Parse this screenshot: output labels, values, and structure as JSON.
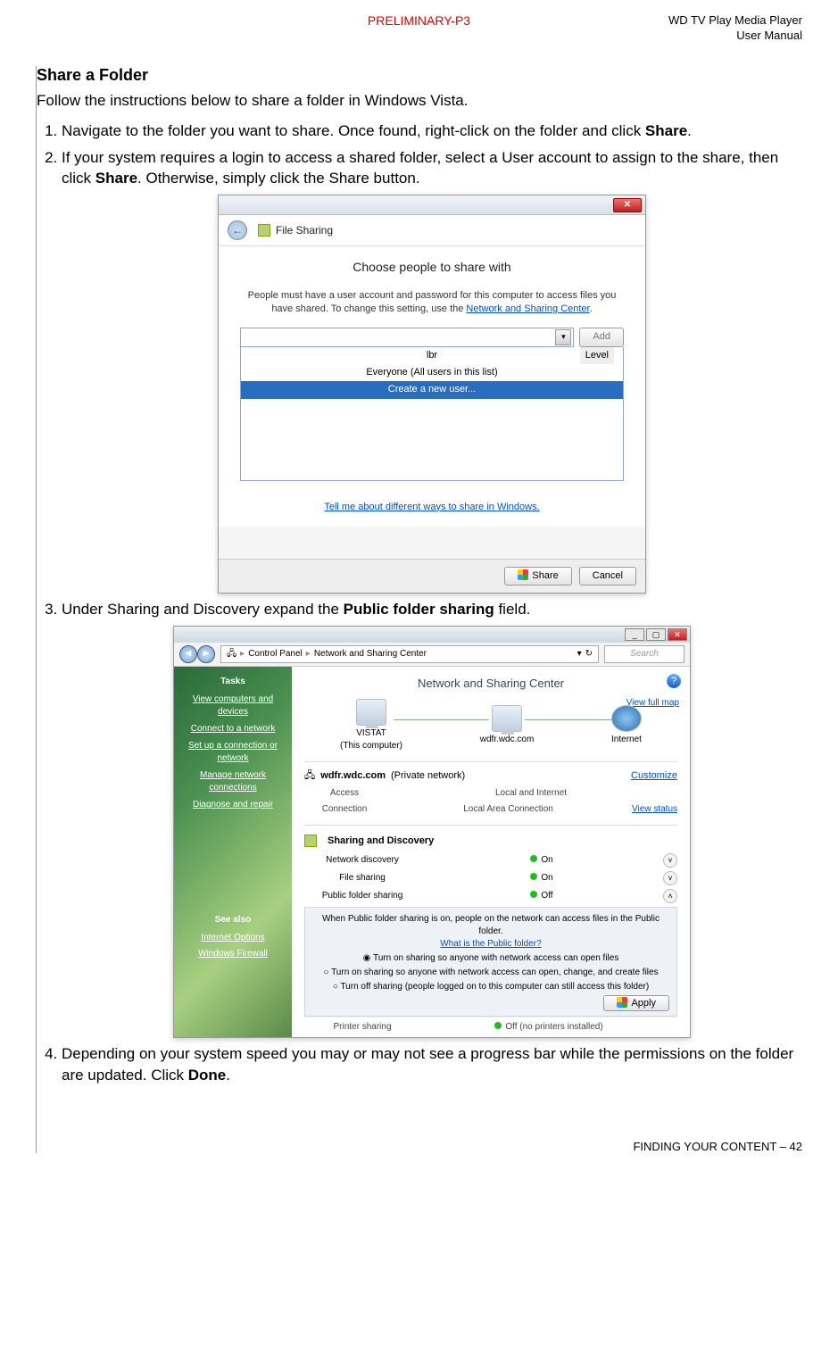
{
  "header": {
    "preliminary": "PRELIMINARY-P3",
    "product": "WD TV Play Media Player",
    "manual": "User Manual"
  },
  "section_title": "Share a Folder",
  "intro": "Follow the instructions below to share a folder in Windows Vista.",
  "steps": {
    "s1_a": "Navigate to the folder you want to share. Once found, right-click on the folder and click ",
    "s1_b": "Share",
    "s1_c": ".",
    "s2_a": "If your system requires a login to access a shared folder, select a User account to assign to the share, then click ",
    "s2_b": "Share",
    "s2_c": ". Otherwise, simply click the Share button.",
    "s3_a": "Under Sharing and Discovery expand the ",
    "s3_b": "Public folder sharing",
    "s3_c": " field.",
    "s4_a": "Depending on your system speed you may or may not see a progress bar while the permissions on the folder are updated. Click ",
    "s4_b": "Done",
    "s4_c": "."
  },
  "shot1": {
    "toolbar_title": "File Sharing",
    "heading": "Choose people to share with",
    "desc_a": "People must have a user account and password for this computer to access files you have shared.  To change this setting, use the ",
    "desc_link": "Network and Sharing Center",
    "desc_b": ".",
    "add_btn": "Add",
    "list": {
      "i0": "lbr",
      "i1": "Everyone (All users in this list)",
      "i2": "Create a new user..."
    },
    "level_label": "Level",
    "help_link": "Tell me about different ways to share in Windows.",
    "share_btn": "Share",
    "cancel_btn": "Cancel"
  },
  "shot2": {
    "breadcrumb": {
      "a": "Control Panel",
      "b": "Network and Sharing Center"
    },
    "search_placeholder": "Search",
    "tasks_h": "Tasks",
    "tasks": {
      "t0": "View computers and devices",
      "t1": "Connect to a network",
      "t2": "Set up a connection or network",
      "t3": "Manage network connections",
      "t4": "Diagnose and repair"
    },
    "see_also": "See also",
    "sa": {
      "a": "Internet Options",
      "b": "Windows Firewall"
    },
    "heading": "Network and Sharing Center",
    "map_link": "View full map",
    "nodes": {
      "pc": "VISTAT",
      "pc_sub": "(This computer)",
      "net": "wdfr.wdc.com",
      "inet": "Internet"
    },
    "network_name": "wdfr.wdc.com",
    "network_type": "(Private network)",
    "customize": "Customize",
    "rows": {
      "access_k": "Access",
      "access_v": "Local and Internet",
      "conn_k": "Connection",
      "conn_v": "Local Area Connection",
      "conn_r": "View status"
    },
    "sd_heading": "Sharing and Discovery",
    "sd": {
      "nd_k": "Network discovery",
      "nd_v": "On",
      "fs_k": "File sharing",
      "fs_v": "On",
      "pf_k": "Public folder sharing",
      "pf_v": "Off"
    },
    "pfs": {
      "line": "When Public folder sharing is on, people on the network can access files in the Public folder.",
      "link": "What is the Public folder?",
      "r0": "Turn on sharing so anyone with network access can open files",
      "r1": "Turn on sharing so anyone with network access can open, change, and create files",
      "r2": "Turn off sharing (people logged on to this computer can still access this folder)",
      "apply": "Apply"
    },
    "printer": {
      "k": "Printer sharing",
      "v": "Off (no printers installed)"
    }
  },
  "footer": {
    "section": "FINDING YOUR CONTENT – ",
    "page": "42"
  }
}
